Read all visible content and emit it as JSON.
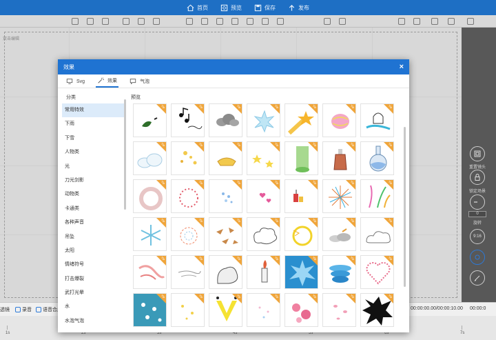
{
  "topbar": {
    "items": [
      {
        "label": "首页",
        "icon": "home-icon"
      },
      {
        "label": "预览",
        "icon": "preview-icon"
      },
      {
        "label": "保存",
        "icon": "save-icon"
      },
      {
        "label": "发布",
        "icon": "publish-icon"
      }
    ]
  },
  "canvas": {
    "hint": "双击编辑"
  },
  "rightpanel": {
    "reset_label": "重置镜头",
    "lock_label": "锁定场景",
    "rotate_label": "旋转",
    "rotate_value": "0",
    "ratio_label": "9:16"
  },
  "bottombar": {
    "items": [
      "透镜",
      "录音",
      "语音合成"
    ],
    "time": "00:00:00.00/00:00:10.00",
    "time2": "00:00:0"
  },
  "timeline": {
    "ticks": [
      "1s",
      "2s",
      "3s",
      "4s",
      "5s",
      "6s",
      "7s"
    ]
  },
  "modal": {
    "title": "效果",
    "close": "×",
    "tabs": [
      {
        "label": "Svg",
        "icon": "svg-icon"
      },
      {
        "label": "效果",
        "icon": "magic-wand-icon",
        "active": true
      },
      {
        "label": "气泡",
        "icon": "speech-bubble-icon"
      }
    ],
    "category_header": "分类",
    "preview_header": "预览",
    "categories": [
      "常用特效",
      "下雨",
      "下雪",
      "人物类",
      "光",
      "刀光剑影",
      "动物类",
      "卡通类",
      "各种声音",
      "吊坠",
      "太阳",
      "情绪符号",
      "打击爆裂",
      "武打光晕",
      "水",
      "水泡气泡"
    ],
    "active_category": "常用特效",
    "badge_text": "Vip",
    "thumbnails": [
      [
        "leaf",
        "music-notes",
        "cloud-gray",
        "ice-splash",
        "shooting-star",
        "pink-swirl",
        "ghost-splash"
      ],
      [
        "cloud-white",
        "gold-sparkles",
        "gold-ingot",
        "yellow-stars",
        "green-beam",
        "potion-bottle",
        "round-flask"
      ],
      [
        "smoke-ring",
        "heart-circle",
        "blue-dots",
        "pink-hearts",
        "firecracker",
        "firework-burst",
        "confetti-burst"
      ],
      [
        "ice-crystal",
        "bubble-burst",
        "brown-shards",
        "comic-cloud",
        "lightning-ring",
        "gray-clouds",
        "cloud-outline"
      ],
      [
        "pink-wind",
        "wind-lines",
        "ink-smoke",
        "fire-bottle",
        "blue-explosion",
        "blue-swirl",
        "heart-outline"
      ],
      [
        "blue-flowers",
        "yellow-dots",
        "yellow-v",
        "sparkle-dots",
        "pink-roses",
        "pink-petals",
        "black-splat"
      ]
    ],
    "vip_rows": [
      true,
      true,
      true,
      true,
      true,
      true
    ]
  }
}
